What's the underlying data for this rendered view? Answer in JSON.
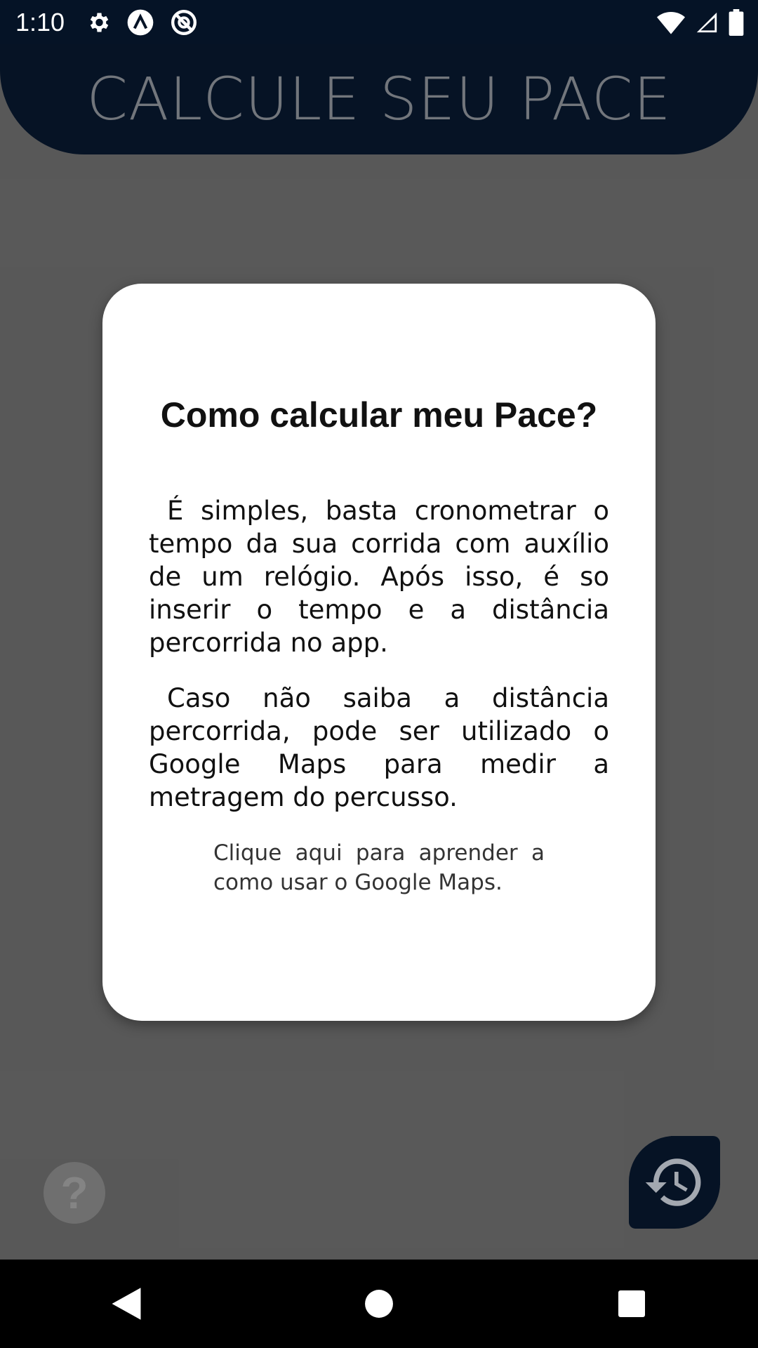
{
  "status_bar": {
    "time": "1:10",
    "left_icons": [
      "settings-icon",
      "app-notification-icon",
      "no-disturb-icon"
    ],
    "right_icons": [
      "wifi-icon",
      "signal-icon",
      "battery-icon"
    ]
  },
  "app": {
    "header_title": "CALCULE SEU PACE",
    "help_button_glyph": "?",
    "history_button_icon": "history-icon"
  },
  "dialog": {
    "title": "Como calcular meu Pace?",
    "paragraph_1": "É simples, basta cronometrar o tempo da sua corrida com auxílio de um relógio. Após isso, é so inserir o tempo e a distância percorrida no app.",
    "paragraph_2": "Caso não saiba a distância percorrida, pode ser utilizado o Google Maps para medir a metragem do percusso.",
    "link_text": "Clique aqui para aprender a como usar o Google Maps."
  },
  "nav_bar": {
    "buttons": [
      "back-icon",
      "home-icon",
      "recents-icon"
    ]
  },
  "colors": {
    "header_bg": "#0a1f3c",
    "status_bar_bg": "#051326",
    "dialog_bg": "#ffffff"
  }
}
